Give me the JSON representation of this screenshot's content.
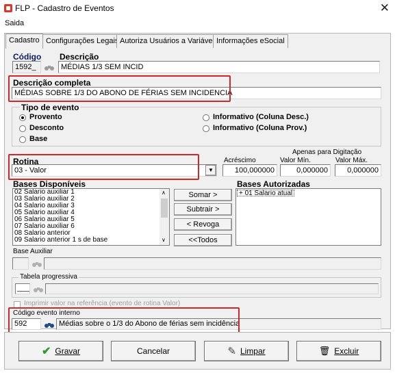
{
  "window": {
    "title": "FLP - Cadastro de Eventos"
  },
  "menu": {
    "saida": "Saida"
  },
  "tabs": [
    {
      "label": "Cadastro"
    },
    {
      "label": "Configurações Legais"
    },
    {
      "label": "Autoriza Usuários a Variáveis"
    },
    {
      "label": "Informações eSocial"
    }
  ],
  "cadastro": {
    "codigo_label": "Código",
    "descricao_label": "Descrição",
    "codigo_value": "1592_",
    "descricao_value": "MÉDIAS 1/3 SEM INCID",
    "desc_completa_label": "Descrição completa",
    "desc_completa_value": "MÉDIAS SOBRE 1/3 DO ABONO DE FÉRIAS SEM INCIDENCIA"
  },
  "tipo_evento": {
    "title": "Tipo de evento",
    "options": [
      "Provento",
      "Desconto",
      "Base",
      "Informativo (Coluna Desc.)",
      "Informativo (Coluna Prov.)"
    ],
    "selected": "Provento"
  },
  "rotina": {
    "label": "Rotina",
    "value": "03 - Valor",
    "apenas_label": "Apenas para Digitação",
    "acrescimo_label": "Acréscimo",
    "valor_min_label": "Valor Mín.",
    "valor_max_label": "Valor Máx.",
    "acrescimo_value": "100,000000",
    "valor_min_value": "0,000000",
    "valor_max_value": "0,000000"
  },
  "bases": {
    "disponiveis_label": "Bases Disponíveis",
    "autorizadas_label": "Bases Autorizadas",
    "disponiveis": [
      "02 Salario auxiliar 1",
      "03 Salario auxiliar 2",
      "04 Salario auxiliar 3",
      "05 Salario auxiliar 4",
      "06 Salario auxiliar 5",
      "07 Salario auxiliar 6",
      "08 Salario anterior",
      "09 Salario anterior 1 s de base"
    ],
    "autorizadas": [
      "+ 01 Salario atual"
    ],
    "btn_somar": "Somar >",
    "btn_subtrair": "Subtrair >",
    "btn_revoga": "< Revoga",
    "btn_todos": "<<Todos"
  },
  "base_auxiliar": {
    "label": "Base Auxiliar",
    "value": ""
  },
  "tabela_progressiva": {
    "label": "Tabela progressiva",
    "value": "___"
  },
  "imprimir": {
    "label": "Imprimir valor na referência (evento de rotina Valor)"
  },
  "evento_interno": {
    "label": "Código evento interno",
    "code": "592",
    "description": "Médias sobre o 1/3 do Abono de férias sem incidência"
  },
  "footer": {
    "gravar": "Gravar",
    "cancelar": "Cancelar",
    "limpar": "Limpar",
    "excluir": "Excluir"
  },
  "colors": {
    "highlight": "#cc2a2a",
    "label_navy": "#0b1a63",
    "panel_bg": "#f0f0f0"
  }
}
